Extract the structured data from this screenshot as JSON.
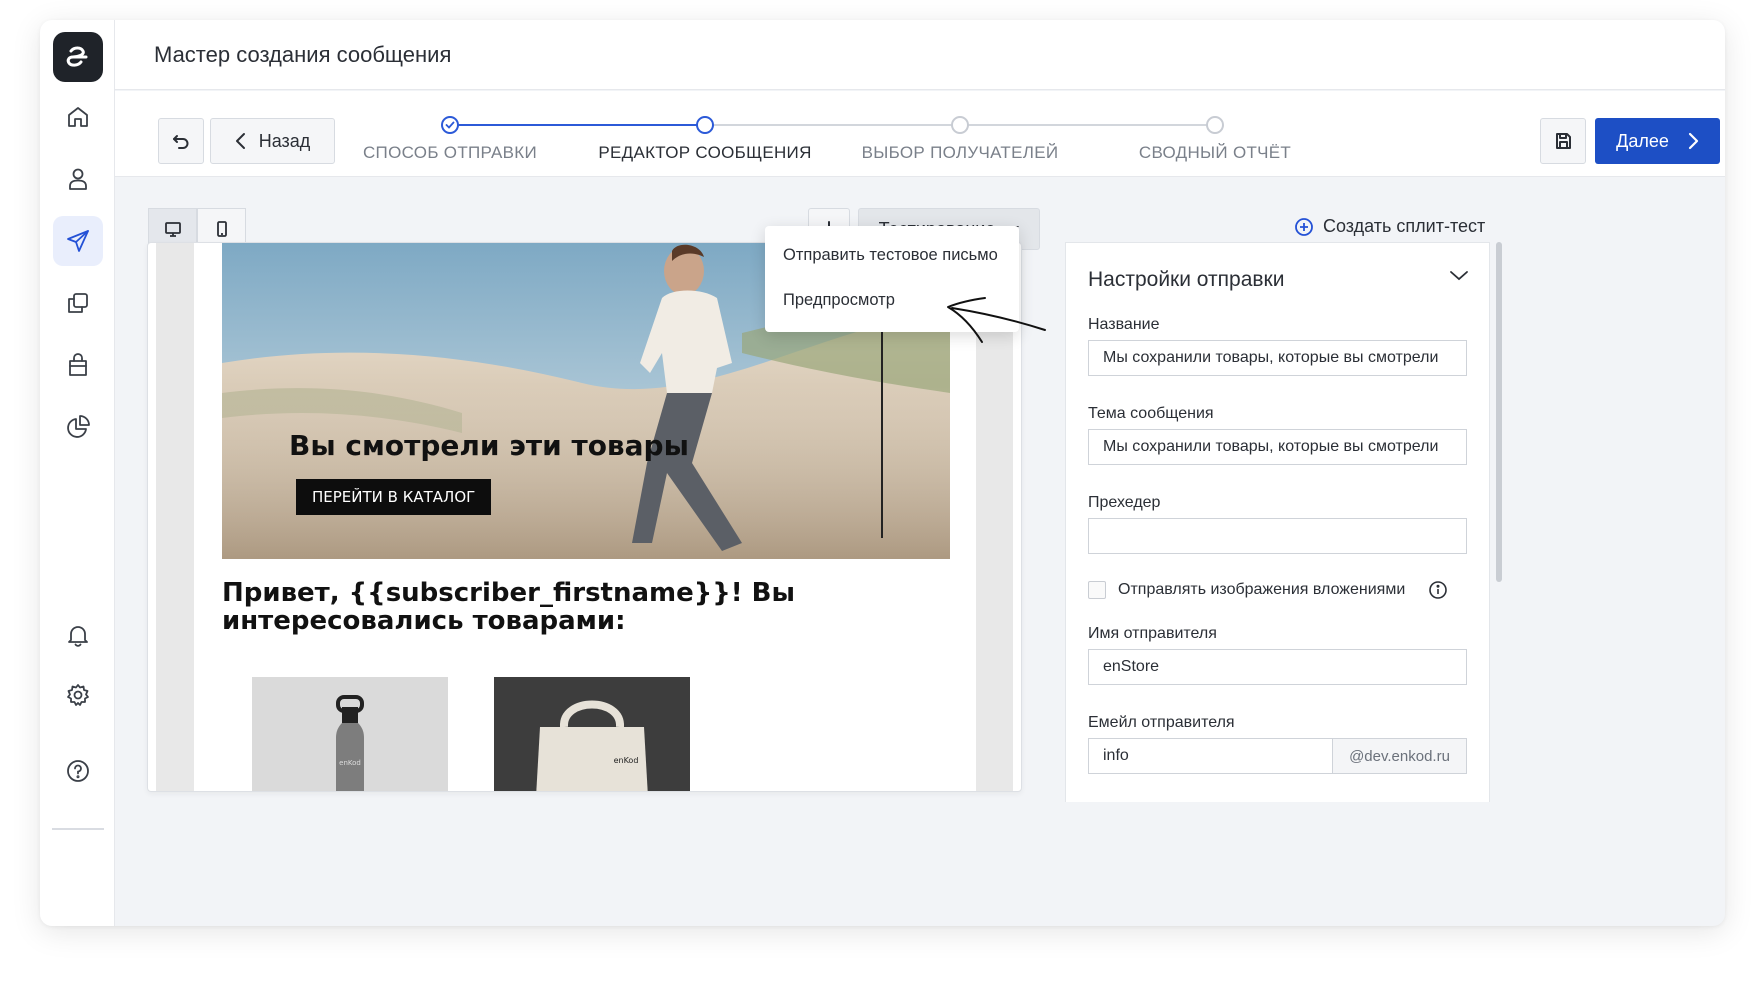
{
  "header": {
    "title": "Мастер создания сообщения"
  },
  "sidebar": {
    "items": [
      {
        "name": "home",
        "icon": "home-icon"
      },
      {
        "name": "contacts",
        "icon": "user-icon"
      },
      {
        "name": "messages",
        "icon": "send-icon",
        "active": true
      },
      {
        "name": "templates",
        "icon": "copy-icon"
      },
      {
        "name": "shop",
        "icon": "bag-icon"
      },
      {
        "name": "analytics",
        "icon": "pie-chart-icon"
      },
      {
        "name": "notifications",
        "icon": "bell-icon"
      },
      {
        "name": "settings",
        "icon": "gear-icon"
      },
      {
        "name": "help",
        "icon": "help-icon"
      }
    ]
  },
  "toolbar": {
    "back_label": "Назад",
    "next_label": "Далее",
    "steps": [
      {
        "label": "СПОСОБ ОТПРАВКИ",
        "state": "done"
      },
      {
        "label": "РЕДАКТОР СООБЩЕНИЯ",
        "state": "current"
      },
      {
        "label": "ВЫБОР ПОЛУЧАТЕЛЕЙ",
        "state": "pending"
      },
      {
        "label": "СВОДНЫЙ ОТЧЁТ",
        "state": "pending"
      }
    ]
  },
  "editor": {
    "testing_label": "Тестирование",
    "split_test_label": "Создать сплит-тест",
    "dropdown": {
      "items": [
        "Отправить тестовое письмо",
        "Предпросмотр"
      ]
    }
  },
  "email": {
    "hero_title": "Вы смотрели эти товары",
    "hero_cta": "ПЕРЕЙТИ В КАТАЛОГ",
    "greeting": "Привет, {{subscriber_firstname}}! Вы интересовались товарами:",
    "product_brand": "enKod"
  },
  "settings": {
    "title": "Настройки отправки",
    "name_label": "Название",
    "name_value": "Мы сохранили товары, которые вы смотрели",
    "subject_label": "Тема сообщения",
    "subject_value": "Мы сохранили товары, которые вы смотрели",
    "preheader_label": "Прехедер",
    "preheader_value": "",
    "attach_images_label": "Отправлять изображения вложениями",
    "attach_images_checked": false,
    "sender_name_label": "Имя отправителя",
    "sender_name_value": "enStore",
    "sender_email_label": "Емейл отправителя",
    "sender_email_value": "info",
    "sender_email_domain": "@dev.enkod.ru"
  },
  "colors": {
    "accent": "#1d4fc5",
    "step_done": "#2c5ad8",
    "sidebar_active_bg": "#e9eefc"
  }
}
